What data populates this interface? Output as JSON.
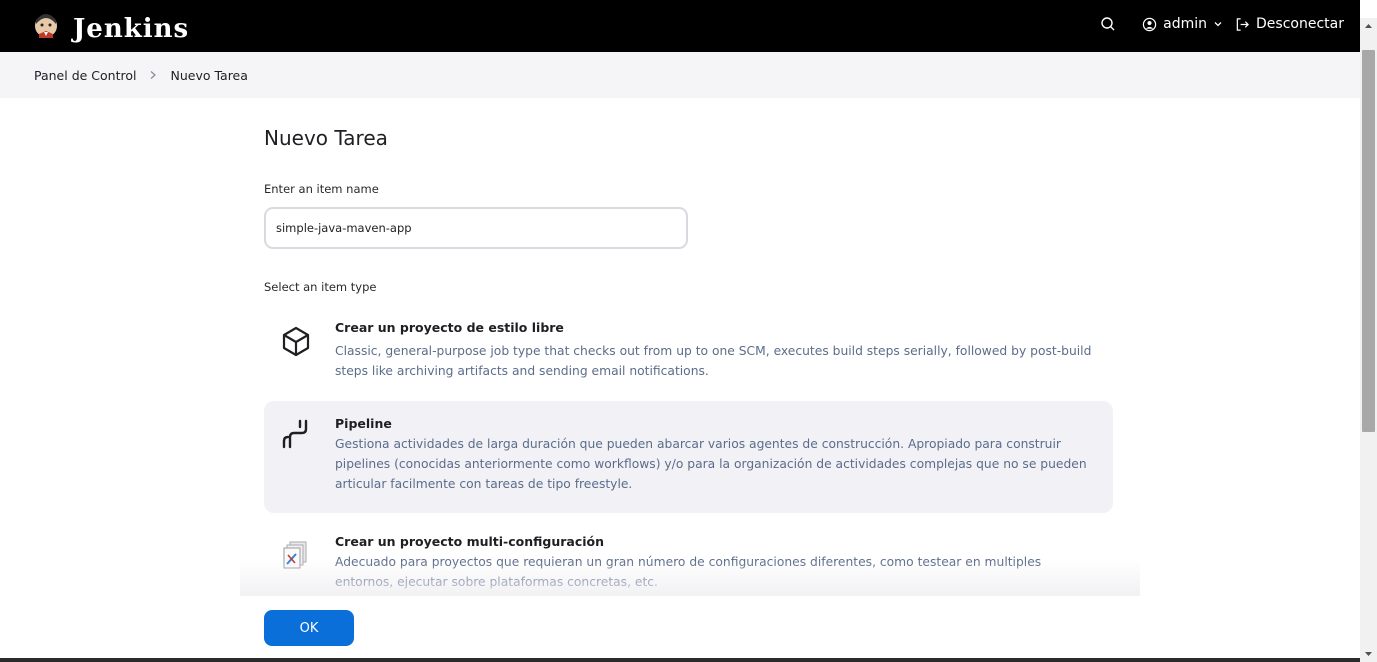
{
  "header": {
    "logo_text": "Jenkins",
    "search_icon": "search-icon",
    "user_name": "admin",
    "logout_label": "Desconectar"
  },
  "breadcrumb": {
    "items": [
      "Panel de Control",
      "Nuevo Tarea"
    ]
  },
  "page": {
    "title": "Nuevo Tarea",
    "name_label": "Enter an item name",
    "name_value": "simple-java-maven-app",
    "type_label": "Select an item type"
  },
  "item_types": [
    {
      "title": "Crear un proyecto de estilo libre",
      "description": "Classic, general-purpose job type that checks out from up to one SCM, executes build steps serially, followed by post-build steps like archiving artifacts and sending email notifications.",
      "icon": "freestyle-box-icon",
      "selected": false
    },
    {
      "title": "Pipeline",
      "description": "Gestiona actividades de larga duración que pueden abarcar varios agentes de construcción. Apropiado para construir pipelines (conocidas anteriormente como workflows) y/o para la organización de actividades complejas que no se pueden articular facilmente con tareas de tipo freestyle.",
      "icon": "pipeline-icon",
      "selected": true
    },
    {
      "title": "Crear un proyecto multi-configuración",
      "description": "Adecuado para proyectos que requieran un gran número de configuraciones diferentes, como testear en multiples entornos, ejecutar sobre plataformas concretas, etc.",
      "icon": "multi-config-icon",
      "selected": false
    }
  ],
  "actions": {
    "ok_label": "OK"
  },
  "colors": {
    "header_bg": "#000000",
    "primary_button": "#0b6fd9",
    "selected_item_bg": "#f1f1f6",
    "description_text": "#5c6d8a"
  }
}
